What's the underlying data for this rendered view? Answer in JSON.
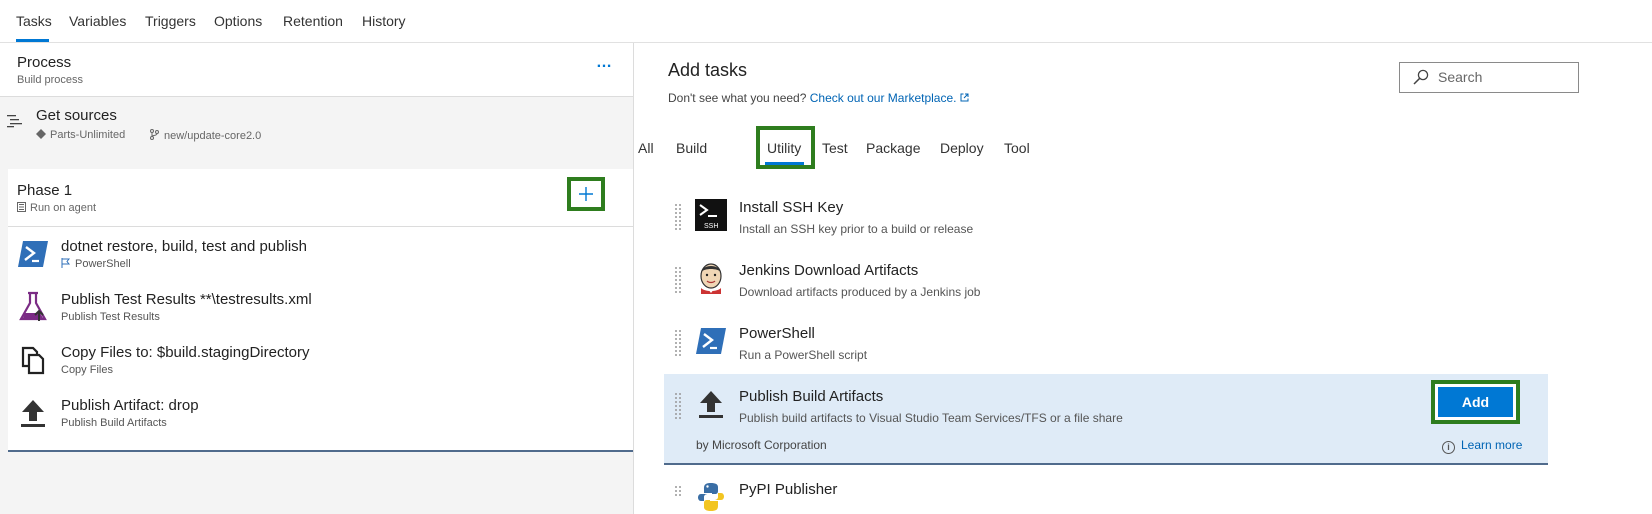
{
  "top_tabs": [
    "Tasks",
    "Variables",
    "Triggers",
    "Options",
    "Retention",
    "History"
  ],
  "process": {
    "title": "Process",
    "subtitle": "Build process",
    "more": "…"
  },
  "get_sources": {
    "title": "Get sources",
    "repo": "Parts-Unlimited",
    "branch": "new/update-core2.0"
  },
  "phase": {
    "title": "Phase 1",
    "subtitle": "Run on agent"
  },
  "tasks": [
    {
      "name": "dotnet restore, build, test and publish",
      "sub": "PowerShell",
      "icon": "powershell-icon"
    },
    {
      "name": "Publish Test Results **\\testresults.xml",
      "sub": "Publish Test Results",
      "icon": "flask-icon"
    },
    {
      "name": "Copy Files to: $build.stagingDirectory",
      "sub": "Copy Files",
      "icon": "copy-files-icon"
    },
    {
      "name": "Publish Artifact: drop",
      "sub": "Publish Build Artifacts",
      "icon": "upload-arrow-icon"
    }
  ],
  "add_tasks": {
    "title": "Add tasks",
    "hint": "Don't see what you need?",
    "marketplace_link": "Check out our Marketplace.",
    "search_placeholder": "Search"
  },
  "categories": [
    "All",
    "Build",
    "Utility",
    "Test",
    "Package",
    "Deploy",
    "Tool"
  ],
  "selected_category": "Utility",
  "catalog": [
    {
      "name": "Install SSH Key",
      "desc": "Install an SSH key prior to a build or release",
      "icon": "ssh-terminal-icon"
    },
    {
      "name": "Jenkins Download Artifacts",
      "desc": "Download artifacts produced by a Jenkins job",
      "icon": "jenkins-icon"
    },
    {
      "name": "PowerShell",
      "desc": "Run a PowerShell script",
      "icon": "powershell-icon"
    },
    {
      "name": "Publish Build Artifacts",
      "desc": "Publish build artifacts to Visual Studio Team Services/TFS or a file share",
      "by": "by Microsoft Corporation",
      "add_label": "Add",
      "learn_more": "Learn more",
      "icon": "upload-arrow-icon"
    },
    {
      "name": "PyPI Publisher",
      "icon": "python-icon"
    }
  ],
  "colors": {
    "accent": "#0078d4",
    "highlight_box": "#2e7d1e",
    "selected_row": "#dfebf7"
  }
}
